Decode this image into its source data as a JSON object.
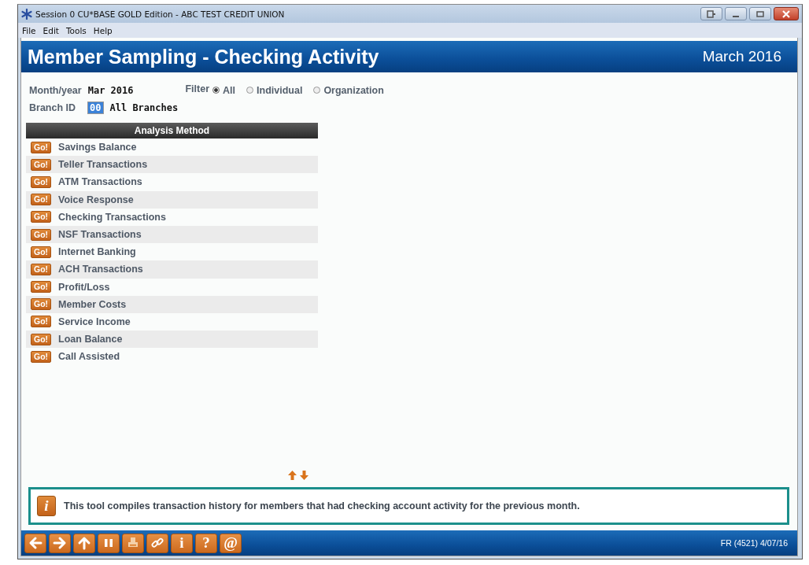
{
  "window": {
    "title": "Session 0 CU*BASE GOLD Edition - ABC TEST CREDIT UNION"
  },
  "menu": [
    "File",
    "Edit",
    "Tools",
    "Help"
  ],
  "header": {
    "title": "Member Sampling - Checking Activity",
    "date": "March 2016"
  },
  "form": {
    "month_label": "Month/year",
    "month_value": "Mar 2016",
    "filter_label": "Filter",
    "filter_options": [
      {
        "label": "All",
        "selected": true
      },
      {
        "label": "Individual",
        "selected": false
      },
      {
        "label": "Organization",
        "selected": false
      }
    ],
    "branch_label": "Branch ID",
    "branch_value": "00",
    "branch_name": "All Branches"
  },
  "analysis": {
    "heading": "Analysis Method",
    "items": [
      {
        "button": "Go!",
        "label": "Savings Balance"
      },
      {
        "button": "Go!",
        "label": "Teller Transactions"
      },
      {
        "button": "Go!",
        "label": "ATM Transactions"
      },
      {
        "button": "Go!",
        "label": "Voice Response"
      },
      {
        "button": "Go!",
        "label": "Checking Transactions"
      },
      {
        "button": "Go!",
        "label": "NSF Transactions"
      },
      {
        "button": "Go!",
        "label": "Internet Banking"
      },
      {
        "button": "Go!",
        "label": "ACH Transactions"
      },
      {
        "button": "Go!",
        "label": "Profit/Loss"
      },
      {
        "button": "Go!",
        "label": "Member Costs"
      },
      {
        "button": "Go!",
        "label": "Service Income"
      },
      {
        "button": "Go!",
        "label": "Loan Balance"
      },
      {
        "button": "Go!",
        "label": "Call Assisted"
      }
    ]
  },
  "info": {
    "icon": "i",
    "message": "This tool compiles transaction history for members that had checking account activity for the previous month."
  },
  "toolbar": [
    {
      "kind": "back"
    },
    {
      "kind": "forward"
    },
    {
      "kind": "up"
    },
    {
      "kind": "pause"
    },
    {
      "kind": "print"
    },
    {
      "kind": "link"
    },
    {
      "kind": "glyph",
      "label": "i"
    },
    {
      "kind": "glyph",
      "label": "?"
    },
    {
      "kind": "glyph",
      "label": "@"
    }
  ],
  "status_bar": "FR (4521) 4/07/16"
}
